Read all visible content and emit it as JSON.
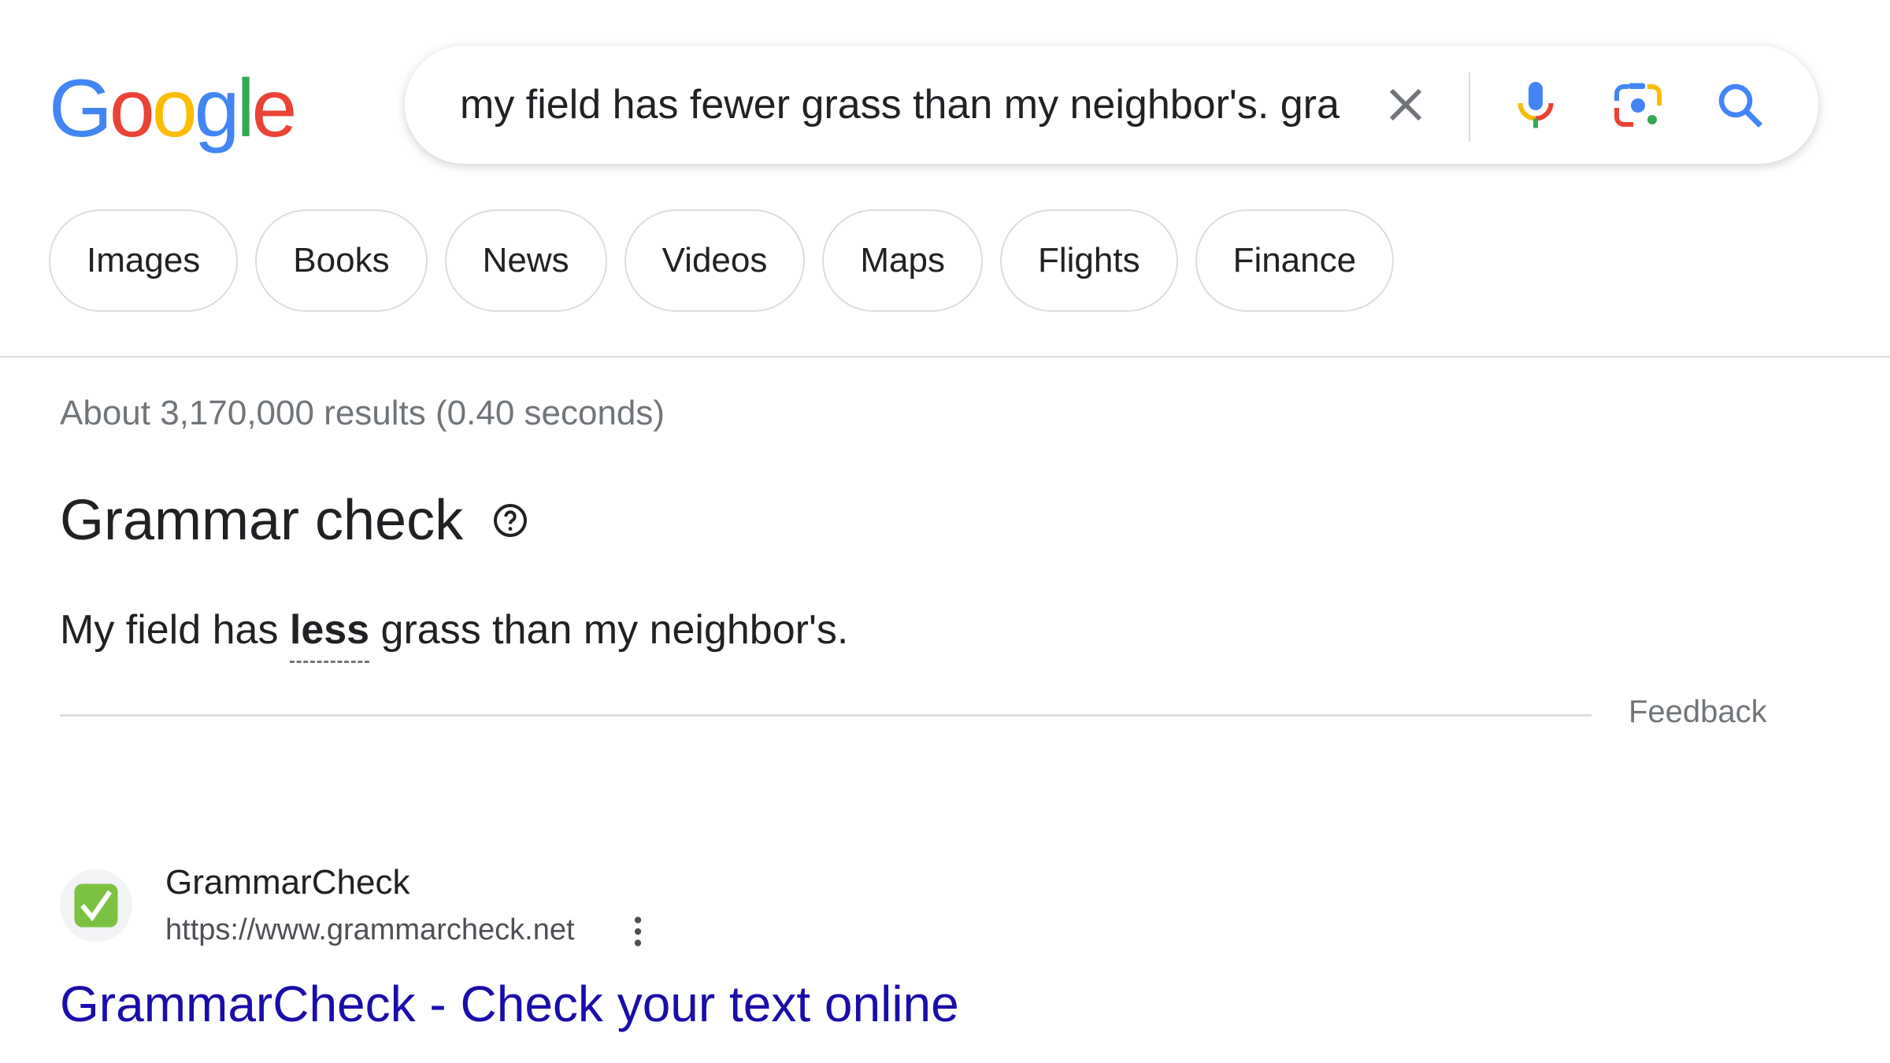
{
  "logo": {
    "letters": [
      {
        "ch": "G",
        "color": "#4285F4"
      },
      {
        "ch": "o",
        "color": "#EA4335"
      },
      {
        "ch": "o",
        "color": "#FBBC05"
      },
      {
        "ch": "g",
        "color": "#4285F4"
      },
      {
        "ch": "l",
        "color": "#34A853"
      },
      {
        "ch": "e",
        "color": "#EA4335"
      }
    ]
  },
  "search": {
    "value": "my field has fewer grass than my neighbor's. gra",
    "icons": [
      "clear-icon",
      "microphone-icon",
      "google-lens-icon",
      "search-icon"
    ]
  },
  "chips": [
    "Images",
    "Books",
    "News",
    "Videos",
    "Maps",
    "Flights",
    "Finance"
  ],
  "results_stats": "About 3,170,000 results (0.40 seconds)",
  "grammar_check": {
    "title": "Grammar check",
    "sentence_before": "My field has ",
    "correction": "less",
    "sentence_after": " grass than my neighbor's.",
    "feedback_label": "Feedback"
  },
  "result": {
    "site_name": "GrammarCheck",
    "url": "https://www.grammarcheck.net",
    "title": "GrammarCheck - Check your text online",
    "favicon_color": "#7cc242"
  },
  "colors": {
    "link": "#1a0dab",
    "muted": "#70757a",
    "border": "#dadce0"
  }
}
